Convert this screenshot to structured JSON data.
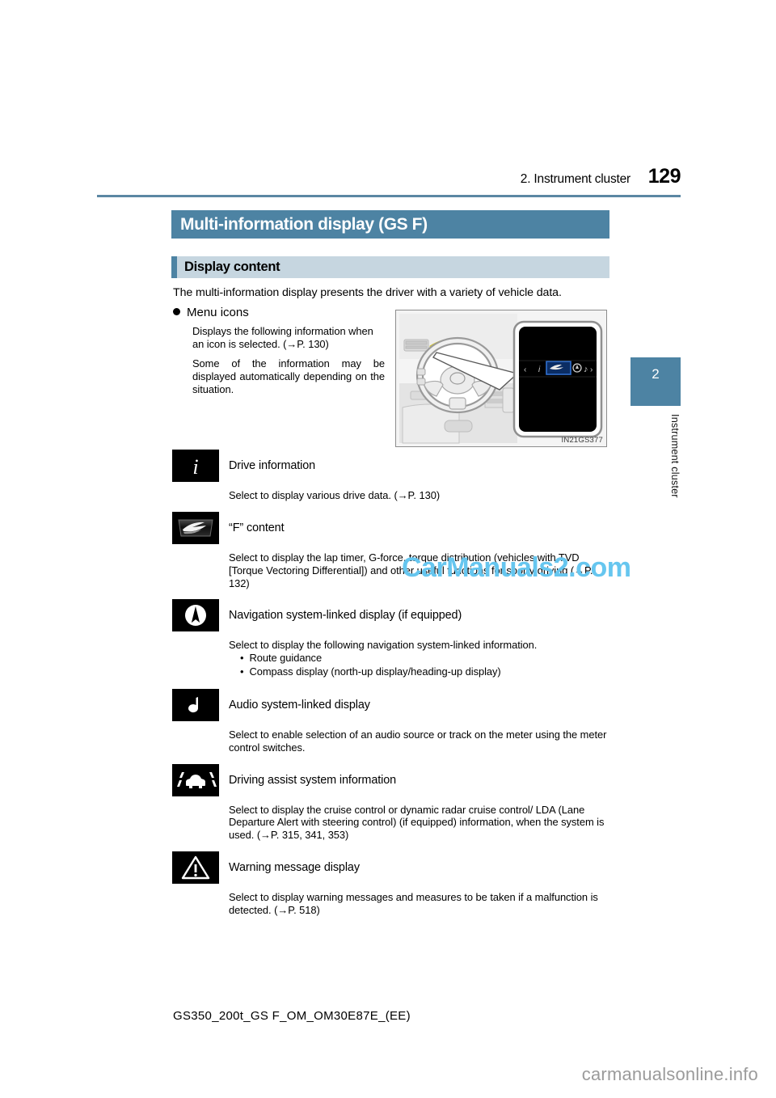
{
  "header": {
    "chapter": "2. Instrument cluster",
    "page_number": "129"
  },
  "section": {
    "title": "Multi-information display (GS F)",
    "subsection_title": "Display content",
    "intro": "The multi-information display presents the driver with a variety of vehicle data."
  },
  "bullet": {
    "heading": "Menu icons",
    "para1": "Displays the following information when an icon is selected. (→P. 130)",
    "para2": "Some of the information may be displayed automatically depending on the situation."
  },
  "figure": {
    "code": "IN21GS377",
    "alt": "steering-wheel-and-multi-information-display"
  },
  "side_tab": {
    "number": "2",
    "label": "Instrument cluster"
  },
  "icon_rows": [
    {
      "icon": "info-i-icon",
      "glyph": "i",
      "label": "Drive information",
      "description": "Select to display various drive data. (→P. 130)",
      "sub_items": []
    },
    {
      "icon": "lexus-f-badge-icon",
      "glyph": "F",
      "label": "“F” content",
      "description": "Select to display the lap timer, G-force, torque distribution (vehicles with TVD [Torque Vectoring Differential]) and other useful functions for sporty driving (→P. 132)",
      "sub_items": []
    },
    {
      "icon": "navigation-compass-icon",
      "glyph": "◖",
      "label": "Navigation system-linked display (if equipped)",
      "description": "Select to display the following navigation system-linked information.",
      "sub_items": [
        "Route guidance",
        "Compass display (north-up display/heading-up display)"
      ]
    },
    {
      "icon": "music-note-icon",
      "glyph": "♪",
      "label": "Audio system-linked display",
      "description": "Select to enable selection of an audio source or track on the meter using the meter control switches.",
      "sub_items": []
    },
    {
      "icon": "driving-assist-lane-car-icon",
      "glyph": "",
      "label": "Driving assist system information",
      "description": "Select to display the cruise control or dynamic radar cruise control/ LDA (Lane Departure Alert with steering control) (if equipped) information, when the system is used. (→P. 315, 341, 353)",
      "sub_items": []
    },
    {
      "icon": "warning-triangle-icon",
      "glyph": "⚠",
      "label": "Warning message display",
      "description": "Select to display warning messages and measures to be taken if a malfunction is detected. (→P. 518)",
      "sub_items": []
    }
  ],
  "sub_bullet_marker": "•",
  "watermarks": {
    "center": "CarManuals2.com",
    "bottom": "carmanualsonline.info"
  },
  "footer": {
    "document_code": "GS350_200t_GS F_OM_OM30E87E_(EE)"
  },
  "colors": {
    "accent_blue": "#4d83a3",
    "subheader_blue": "#c6d6e0",
    "rule_blue": "#5b87a3",
    "watermark_blue": "#66c6ef",
    "highlight_yellow": "#f5e642"
  }
}
